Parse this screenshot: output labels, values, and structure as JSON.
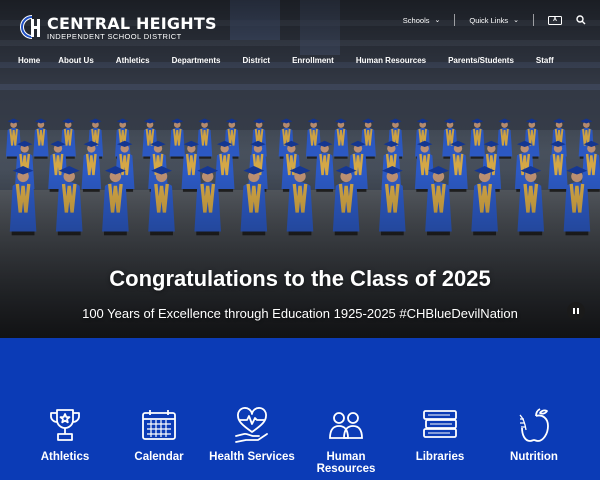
{
  "header": {
    "logo_title": "CENTRAL HEIGHTS",
    "logo_subtitle": "INDEPENDENT SCHOOL DISTRICT",
    "logo_icon": "ch-monogram",
    "util_links": [
      {
        "label": "Schools",
        "icon": "chevron-down-icon"
      },
      {
        "label": "Quick Links",
        "icon": "chevron-down-icon"
      }
    ],
    "translate_icon": "translate-icon",
    "search_icon": "search-icon",
    "nav": [
      "Home",
      "About Us",
      "Athletics",
      "Departments",
      "District",
      "Enrollment",
      "Human Resources",
      "Parents/Students",
      "Staff"
    ]
  },
  "hero": {
    "title": "Congratulations to the Class of 2025",
    "subtitle": "100 Years of Excellence through Education 1925-2025 #CHBlueDevilNation",
    "pause_icon": "pause-icon"
  },
  "quick_links": [
    {
      "label": "Athletics",
      "icon": "trophy-icon"
    },
    {
      "label": "Calendar",
      "icon": "calendar-icon"
    },
    {
      "label": "Health Services",
      "icon": "heart-hand-icon"
    },
    {
      "label": "Human Resources",
      "icon": "people-icon"
    },
    {
      "label": "Libraries",
      "icon": "books-icon"
    },
    {
      "label": "Nutrition",
      "icon": "apple-icon"
    }
  ],
  "colors": {
    "brand_blue": "#0b3bb6",
    "gown_blue": "#2f5fd0",
    "stole_gold": "#e0b14a"
  }
}
